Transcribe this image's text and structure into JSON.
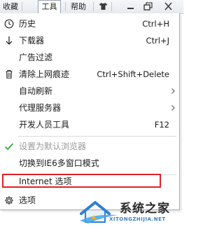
{
  "menubar": {
    "items": [
      "收藏",
      "工具",
      "帮助"
    ],
    "active_index": 1
  },
  "menu": {
    "items": [
      {
        "label": "历史",
        "shortcut": "Ctrl+H",
        "icon": "clock-icon"
      },
      {
        "label": "下载器",
        "shortcut": "Ctrl+J",
        "icon": "download-arrow-icon"
      },
      {
        "label": "广告过滤",
        "shortcut": "",
        "icon": ""
      },
      {
        "label": "清除上网痕迹",
        "shortcut": "Ctrl+Shift+Delete",
        "icon": "trash-icon"
      },
      {
        "label": "自动刷新",
        "shortcut": "",
        "icon": "",
        "submenu": true
      },
      {
        "label": "代理服务器",
        "shortcut": "",
        "icon": "",
        "submenu": true
      },
      {
        "label": "开发人员工具",
        "shortcut": "F12",
        "icon": ""
      },
      {
        "label": "设置为默认浏览器",
        "shortcut": "",
        "icon": "checkmark-icon",
        "disabled": true
      },
      {
        "label": "切换到IE6多窗口模式",
        "shortcut": "",
        "icon": ""
      },
      {
        "label": "Internet 选项",
        "shortcut": "",
        "icon": "",
        "highlighted": true
      },
      {
        "label": "选项",
        "shortcut": "",
        "icon": "gear-icon"
      }
    ]
  },
  "watermark": {
    "text_cn": "系统之家",
    "text_en": "XITONGZHIJIA.NET"
  },
  "colors": {
    "highlight_border": "#e0212a",
    "check_green": "#3aa83a",
    "disabled_text": "#9a9a9a",
    "watermark_blue": "#3a7fc0"
  }
}
